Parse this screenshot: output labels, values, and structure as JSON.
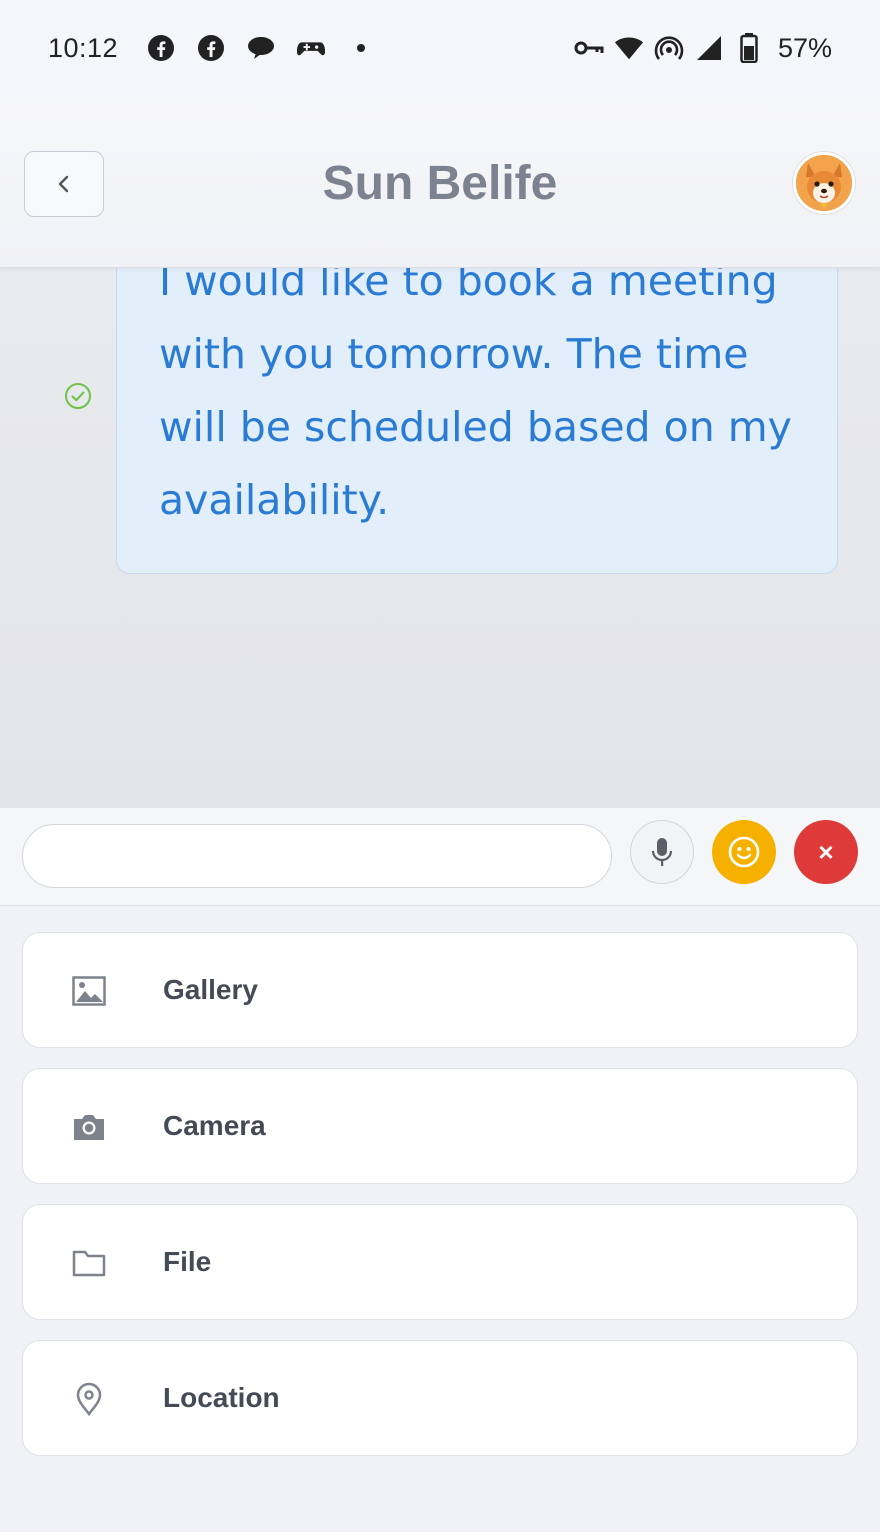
{
  "status_bar": {
    "time": "10:12",
    "notification_icons": [
      "facebook-icon",
      "facebook-icon",
      "chat-bubble-icon",
      "game-controller-icon",
      "dot-icon"
    ],
    "system_icons": [
      "vpn-key-icon",
      "wifi-icon",
      "hotspot-icon",
      "signal-icon",
      "battery-icon"
    ],
    "battery": "57%"
  },
  "header": {
    "title": "Sun Belife",
    "back_icon": "chevron-left-icon",
    "avatar": "corgi-avatar"
  },
  "chat": {
    "message": "I would like to book a meeting with you tomorrow. The time will be scheduled based on my availability.",
    "status_icon": "check-circle-icon",
    "colors": {
      "bubble_bg": "#e3eefb",
      "text": "#2a7bd4",
      "check": "#6cc24a"
    }
  },
  "input_bar": {
    "value": "",
    "placeholder": "",
    "mic_icon": "microphone-icon",
    "emoji_icon": "smiley-icon",
    "close_label": "×",
    "colors": {
      "emoji_bg": "#f6b100",
      "close_bg": "#df3a3a"
    }
  },
  "attachments": [
    {
      "label": "Gallery",
      "icon": "image-icon"
    },
    {
      "label": "Camera",
      "icon": "camera-icon"
    },
    {
      "label": "File",
      "icon": "folder-icon"
    },
    {
      "label": "Location",
      "icon": "location-pin-icon"
    }
  ]
}
